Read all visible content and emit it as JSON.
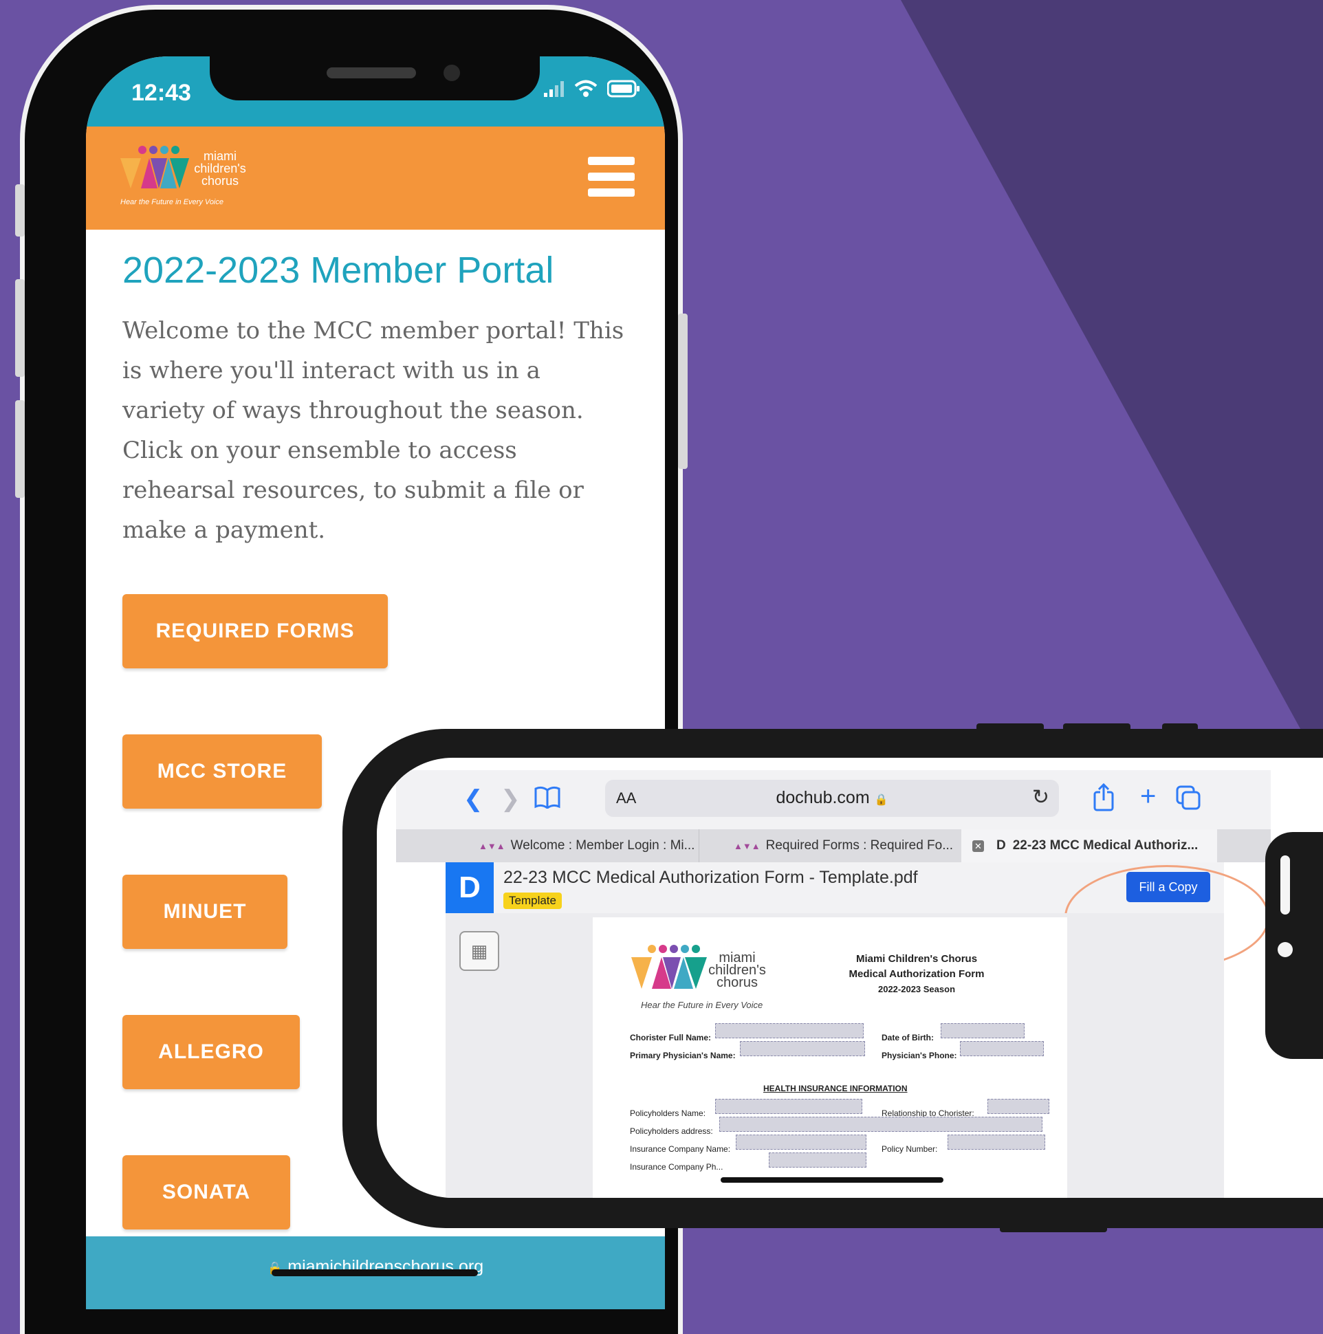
{
  "background": {
    "primary": "#6a52a3",
    "secondary": "#4b3b76"
  },
  "phone_portrait": {
    "status_time": "12:43",
    "logo": {
      "line1": "miami",
      "line2": "children's",
      "line3": "chorus",
      "tagline": "Hear the Future in Every Voice"
    },
    "menu_icon": "hamburger-icon",
    "title": "2022-2023 Member Portal",
    "intro": "Welcome to the MCC member portal! This is where you'll interact with us in a variety of ways throughout the season. Click on your ensemble to access rehearsal resources, to submit a file or make a payment.",
    "buttons": [
      "REQUIRED FORMS",
      "MCC STORE",
      "MINUET",
      "ALLEGRO",
      "SONATA"
    ],
    "url": "miamichildrenschorus.org",
    "colors": {
      "status_bar": "#1fa3bd",
      "header": "#f4953a",
      "title": "#1fa3bd",
      "button": "#f4953a",
      "url_bar": "#3fa9c4"
    }
  },
  "phone_landscape": {
    "toolbar": {
      "text_size": "AA",
      "address": "dochub.com",
      "icons": [
        "back-icon",
        "forward-icon",
        "bookmarks-icon",
        "lock-icon",
        "reload-icon",
        "share-icon",
        "new-tab-icon",
        "tabs-icon"
      ]
    },
    "tabs": [
      "Welcome : Member Login : Mi...",
      "Required Forms : Required Fo...",
      "22-23 MCC Medical Authoriz..."
    ],
    "document": {
      "logo_letter": "D",
      "filename": "22-23 MCC Medical Authorization Form - Template.pdf",
      "badge": "Template",
      "fill_button": "Fill a Copy"
    },
    "pdf": {
      "logo": {
        "line1": "miami",
        "line2": "children's",
        "line3": "chorus",
        "tagline": "Hear the Future in Every Voice"
      },
      "org_name": "Miami Children's Chorus",
      "form_name": "Medical Authorization Form",
      "season": "2022-2023 Season",
      "labels": {
        "chorister_name": "Chorister Full Name:",
        "dob": "Date of Birth:",
        "physician_name": "Primary Physician's Name:",
        "physician_phone": "Physician's Phone:",
        "section": "HEALTH INSURANCE INFORMATION",
        "policyholder_name": "Policyholders Name:",
        "relationship": "Relationship to Chorister:",
        "policyholder_address": "Policyholders address:",
        "insurance_company": "Insurance Company Name:",
        "policy_number": "Policy Number:",
        "insurance_phone": "Insurance Company Ph..."
      }
    },
    "colors": {
      "fill_button": "#1d5fe0",
      "badge": "#f7d21c",
      "doc_logo": "#1877f2",
      "highlight_ring": "#f2a37e"
    }
  }
}
